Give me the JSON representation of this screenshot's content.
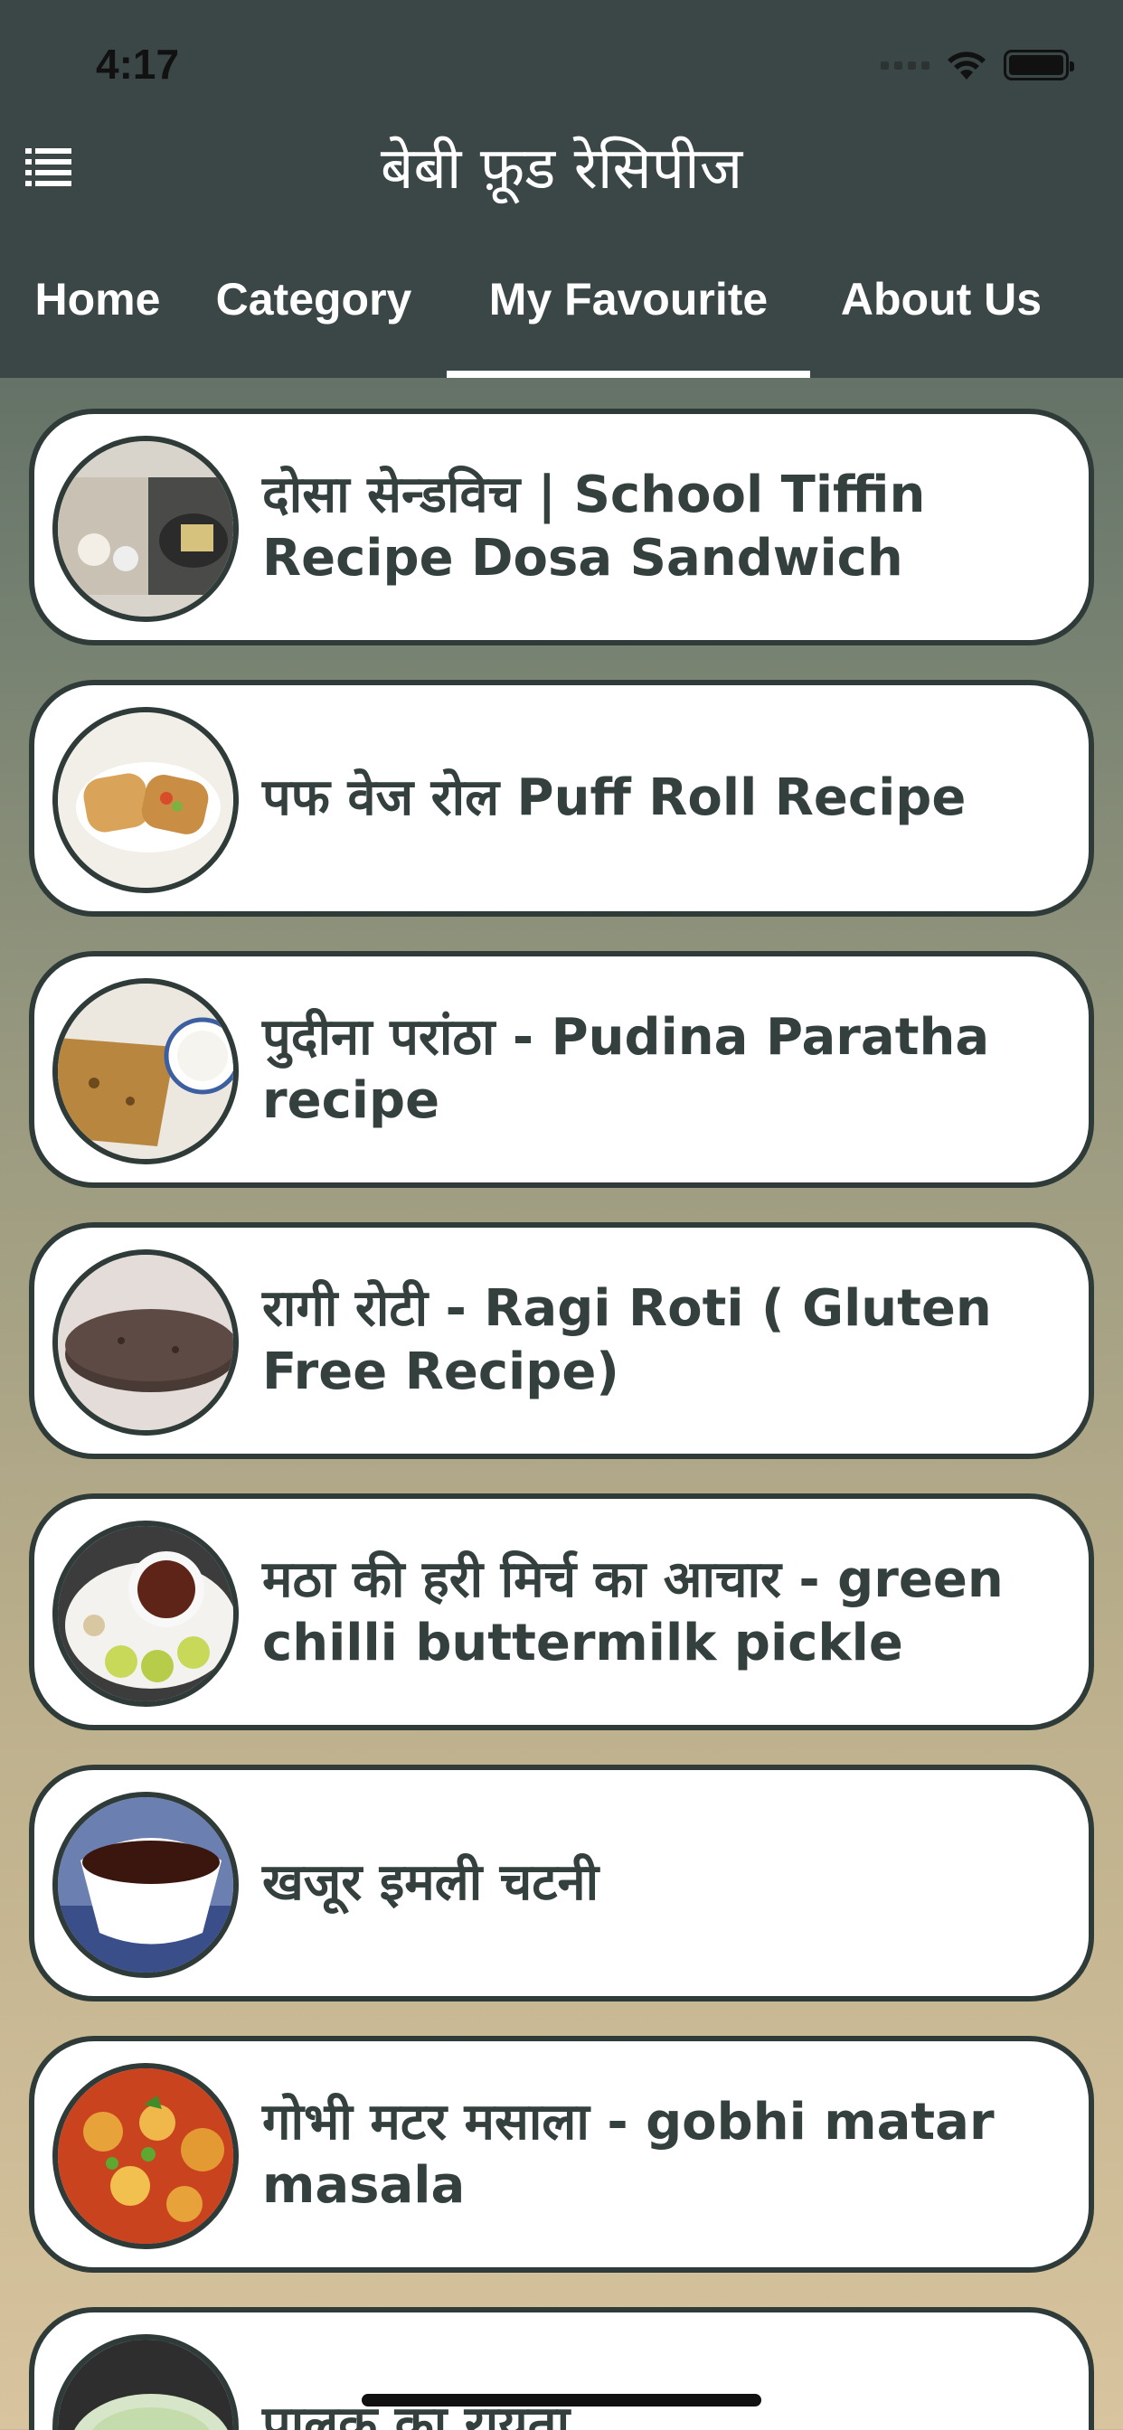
{
  "status_bar": {
    "time": "4:17"
  },
  "header": {
    "title": "बेबी फ़ूड रेसिपीज",
    "menu_icon": "list-menu-icon",
    "bg_color": "#3b4746"
  },
  "tabs": [
    {
      "label": "Home"
    },
    {
      "label": "Category"
    },
    {
      "label": "My Favourite",
      "selected": true
    },
    {
      "label": "About Us"
    }
  ],
  "recipes": [
    {
      "title": "दोसा सेन्डविच | School Tiffin Recipe Dosa Sandwich",
      "image": "dosa-sandwich-thumbnail"
    },
    {
      "title": "पफ वेज रोल Puff Roll Recipe",
      "image": "puff-roll-thumbnail"
    },
    {
      "title": "पुदीना परांठा - Pudina Paratha recipe",
      "image": "pudina-paratha-thumbnail"
    },
    {
      "title": "रागी रोटी - Ragi Roti ( Gluten Free Recipe)",
      "image": "ragi-roti-thumbnail"
    },
    {
      "title": "मठा की हरी मिर्च का आचार - green chilli buttermilk pickle",
      "image": "chilli-pickle-thumbnail"
    },
    {
      "title": "खजूर इमली चटनी",
      "image": "khajur-imli-chutney-thumbnail"
    },
    {
      "title": "गोभी मटर मसाला - gobhi matar masala",
      "image": "gobhi-matar-thumbnail"
    },
    {
      "title": "पालक का रायता",
      "image": "palak-raita-thumbnail"
    }
  ],
  "colors": {
    "accent_border": "#2f3b38",
    "text": "#33403d"
  }
}
